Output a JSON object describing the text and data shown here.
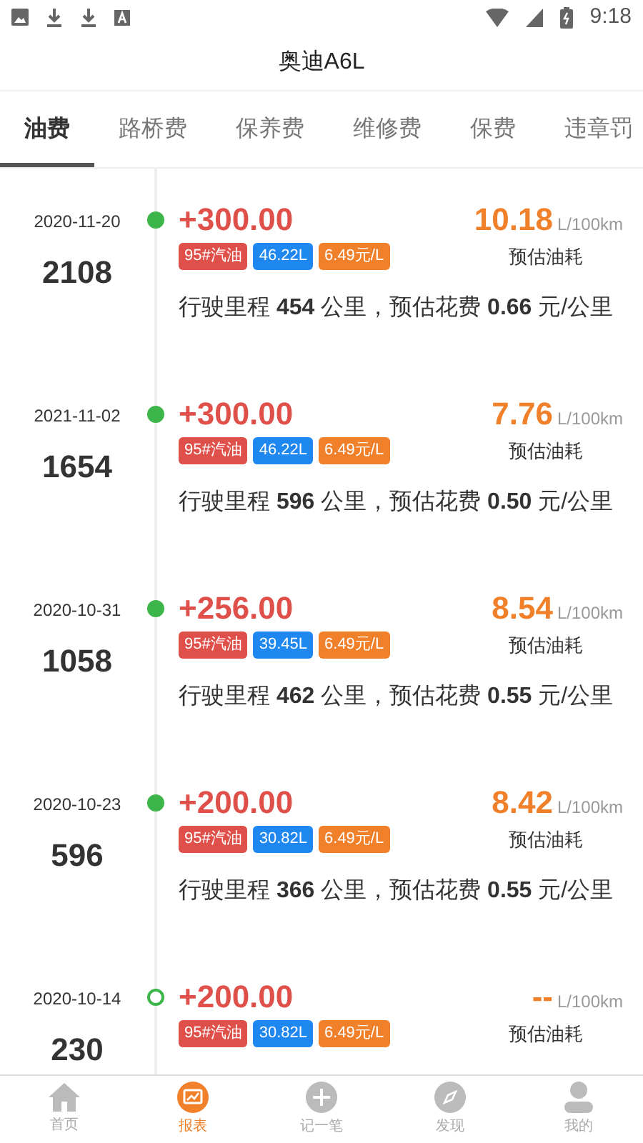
{
  "status_bar": {
    "time": "9:18"
  },
  "title": "奥迪A6L",
  "tabs": [
    {
      "label": "油费",
      "selected": true
    },
    {
      "label": "路桥费",
      "selected": false
    },
    {
      "label": "保养费",
      "selected": false
    },
    {
      "label": "维修费",
      "selected": false
    },
    {
      "label": "保费",
      "selected": false
    },
    {
      "label": "违章罚",
      "selected": false
    }
  ],
  "entries": [
    {
      "date": "2020-11-20",
      "mileage": "2108",
      "filled": true,
      "amount": "+300.00",
      "tags": [
        "95#汽油",
        "46.22L",
        "6.49元/L"
      ],
      "consumption": "10.18",
      "unit": "L/100km",
      "consumption_label": "预估油耗",
      "summary": "行驶里程 **454** 公里，预估花费 **0.66** 元/公里"
    },
    {
      "date": "2021-11-02",
      "mileage": "1654",
      "filled": true,
      "amount": "+300.00",
      "tags": [
        "95#汽油",
        "46.22L",
        "6.49元/L"
      ],
      "consumption": "7.76",
      "unit": "L/100km",
      "consumption_label": "预估油耗",
      "summary": "行驶里程 **596** 公里，预估花费 **0.50** 元/公里"
    },
    {
      "date": "2020-10-31",
      "mileage": "1058",
      "filled": true,
      "amount": "+256.00",
      "tags": [
        "95#汽油",
        "39.45L",
        "6.49元/L"
      ],
      "consumption": "8.54",
      "unit": "L/100km",
      "consumption_label": "预估油耗",
      "summary": "行驶里程 **462** 公里，预估花费 **0.55** 元/公里"
    },
    {
      "date": "2020-10-23",
      "mileage": "596",
      "filled": true,
      "amount": "+200.00",
      "tags": [
        "95#汽油",
        "30.82L",
        "6.49元/L"
      ],
      "consumption": "8.42",
      "unit": "L/100km",
      "consumption_label": "预估油耗",
      "summary": "行驶里程 **366** 公里，预估花费 **0.55** 元/公里"
    },
    {
      "date": "2020-10-14",
      "mileage": "230",
      "filled": false,
      "amount": "+200.00",
      "tags": [
        "95#汽油",
        "30.82L",
        "6.49元/L"
      ],
      "consumption": "--",
      "unit": "L/100km",
      "consumption_label": "预估油耗"
    }
  ],
  "nav": [
    {
      "label": "首页",
      "kind": "home",
      "selected": false
    },
    {
      "label": "报表",
      "kind": "report",
      "selected": true
    },
    {
      "label": "记一笔",
      "kind": "add",
      "selected": false
    },
    {
      "label": "发现",
      "kind": "discover",
      "selected": false
    },
    {
      "label": "我的",
      "kind": "me",
      "selected": false
    }
  ]
}
